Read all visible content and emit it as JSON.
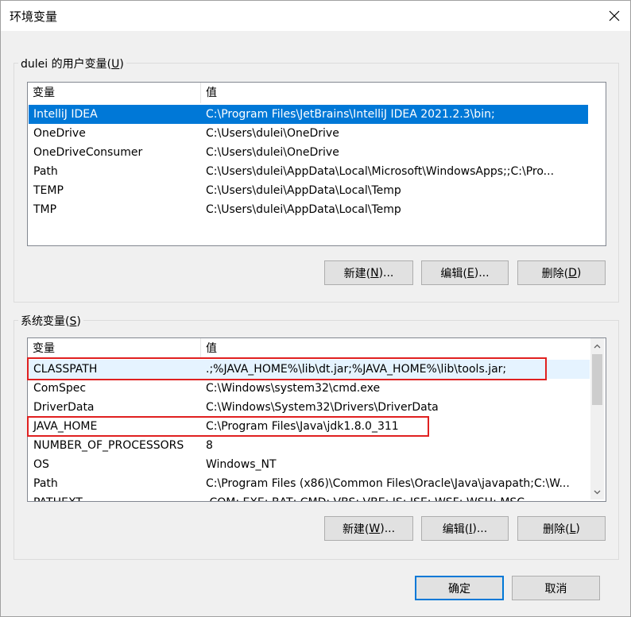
{
  "window": {
    "title": "环境变量"
  },
  "user_vars": {
    "group_label_prefix": "dulei 的用户变量(",
    "group_label_key": "U",
    "group_label_suffix": ")",
    "col_name": "变量",
    "col_value": "值",
    "rows": [
      {
        "name": "IntelliJ IDEA",
        "value": "C:\\Program Files\\JetBrains\\IntelliJ IDEA 2021.2.3\\bin;"
      },
      {
        "name": "OneDrive",
        "value": "C:\\Users\\dulei\\OneDrive"
      },
      {
        "name": "OneDriveConsumer",
        "value": "C:\\Users\\dulei\\OneDrive"
      },
      {
        "name": "Path",
        "value": "C:\\Users\\dulei\\AppData\\Local\\Microsoft\\WindowsApps;;C:\\Pro..."
      },
      {
        "name": "TEMP",
        "value": "C:\\Users\\dulei\\AppData\\Local\\Temp"
      },
      {
        "name": "TMP",
        "value": "C:\\Users\\dulei\\AppData\\Local\\Temp"
      }
    ],
    "buttons": {
      "new": {
        "pre": "新建(",
        "key": "N",
        "post": ")..."
      },
      "edit": {
        "pre": "编辑(",
        "key": "E",
        "post": ")..."
      },
      "delete": {
        "pre": "删除(",
        "key": "D",
        "post": ")"
      }
    }
  },
  "system_vars": {
    "group_label_prefix": "系统变量(",
    "group_label_key": "S",
    "group_label_suffix": ")",
    "col_name": "变量",
    "col_value": "值",
    "rows": [
      {
        "name": "CLASSPATH",
        "value": ".;%JAVA_HOME%\\lib\\dt.jar;%JAVA_HOME%\\lib\\tools.jar;"
      },
      {
        "name": "ComSpec",
        "value": "C:\\Windows\\system32\\cmd.exe"
      },
      {
        "name": "DriverData",
        "value": "C:\\Windows\\System32\\Drivers\\DriverData"
      },
      {
        "name": "JAVA_HOME",
        "value": "C:\\Program Files\\Java\\jdk1.8.0_311"
      },
      {
        "name": "NUMBER_OF_PROCESSORS",
        "value": "8"
      },
      {
        "name": "OS",
        "value": "Windows_NT"
      },
      {
        "name": "Path",
        "value": "C:\\Program Files (x86)\\Common Files\\Oracle\\Java\\javapath;C:\\W..."
      },
      {
        "name": "PATHEXT",
        "value": ".COM;.EXE;.BAT;.CMD;.VBS;.VBE;.JS;.JSE;.WSF;.WSH;.MSC"
      }
    ],
    "buttons": {
      "new": {
        "pre": "新建(",
        "key": "W",
        "post": ")..."
      },
      "edit": {
        "pre": "编辑(",
        "key": "I",
        "post": ")..."
      },
      "delete": {
        "pre": "删除(",
        "key": "L",
        "post": ")"
      }
    }
  },
  "footer": {
    "ok_label": "确定",
    "cancel_label": "取消"
  },
  "colors": {
    "selection": "#0078d7",
    "highlight_box": "#e02020"
  },
  "icons": {
    "close": "close-icon",
    "scroll_up": "chevron-up-icon",
    "scroll_down": "chevron-down-icon"
  }
}
